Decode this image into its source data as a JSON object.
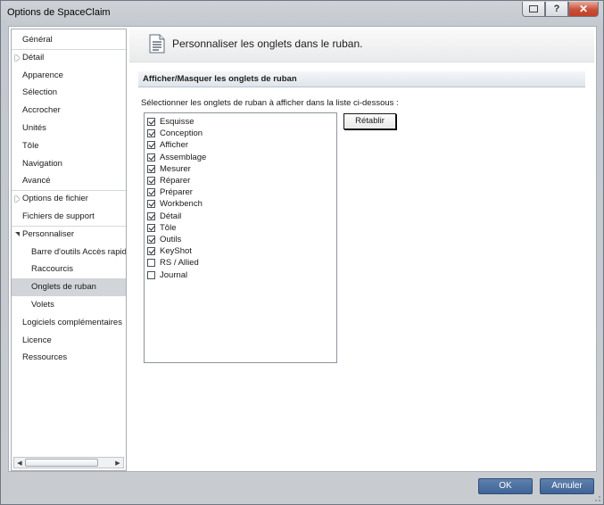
{
  "window": {
    "title": "Options de SpaceClaim"
  },
  "sidebar": {
    "items": [
      {
        "label": "Général",
        "indent": 0,
        "expander": "none",
        "selected": false
      },
      {
        "label": "Détail",
        "indent": 0,
        "expander": "collapsed",
        "selected": false
      },
      {
        "label": "Apparence",
        "indent": 0,
        "expander": "none",
        "selected": false
      },
      {
        "label": "Sélection",
        "indent": 0,
        "expander": "none",
        "selected": false
      },
      {
        "label": "Accrocher",
        "indent": 0,
        "expander": "none",
        "selected": false
      },
      {
        "label": "Unités",
        "indent": 0,
        "expander": "none",
        "selected": false
      },
      {
        "label": "Tôle",
        "indent": 0,
        "expander": "none",
        "selected": false
      },
      {
        "label": "Navigation",
        "indent": 0,
        "expander": "none",
        "selected": false
      },
      {
        "label": "Avancé",
        "indent": 0,
        "expander": "none",
        "selected": false
      },
      {
        "label": "Options de fichier",
        "indent": 0,
        "expander": "collapsed",
        "selected": false
      },
      {
        "label": "Fichiers de support",
        "indent": 0,
        "expander": "none",
        "selected": false
      },
      {
        "label": "Personnaliser",
        "indent": 0,
        "expander": "expanded",
        "selected": false
      },
      {
        "label": "Barre d'outils Accès rapide",
        "indent": 1,
        "expander": "none",
        "selected": false
      },
      {
        "label": "Raccourcis",
        "indent": 1,
        "expander": "none",
        "selected": false
      },
      {
        "label": "Onglets de ruban",
        "indent": 1,
        "expander": "none",
        "selected": true
      },
      {
        "label": "Volets",
        "indent": 1,
        "expander": "none",
        "selected": false
      },
      {
        "label": "Logiciels complémentaires",
        "indent": 0,
        "expander": "none",
        "selected": false
      },
      {
        "label": "Licence",
        "indent": 0,
        "expander": "none",
        "selected": false
      },
      {
        "label": "Ressources",
        "indent": 0,
        "expander": "none",
        "selected": false
      }
    ]
  },
  "header": {
    "title": "Personnaliser les onglets dans le ruban."
  },
  "section": {
    "title": "Afficher/Masquer les onglets de ruban",
    "description": "Sélectionner les onglets de ruban à afficher dans la liste ci-dessous :",
    "reset_label": "Rétablir",
    "tabs": [
      {
        "label": "Esquisse",
        "checked": true
      },
      {
        "label": "Conception",
        "checked": true
      },
      {
        "label": "Afficher",
        "checked": true
      },
      {
        "label": "Assemblage",
        "checked": true
      },
      {
        "label": "Mesurer",
        "checked": true
      },
      {
        "label": "Réparer",
        "checked": true
      },
      {
        "label": "Préparer",
        "checked": true
      },
      {
        "label": "Workbench",
        "checked": true
      },
      {
        "label": "Détail",
        "checked": true
      },
      {
        "label": "Tôle",
        "checked": true
      },
      {
        "label": "Outils",
        "checked": true
      },
      {
        "label": "KeyShot",
        "checked": true
      },
      {
        "label": "RS / Allied",
        "checked": false
      },
      {
        "label": "Journal",
        "checked": false
      }
    ]
  },
  "footer": {
    "ok_label": "OK",
    "cancel_label": "Annuler"
  },
  "colors": {
    "accent_button": "#4a6e9f",
    "selected_nav": "#d1d4d8",
    "close_button": "#c8503a"
  }
}
